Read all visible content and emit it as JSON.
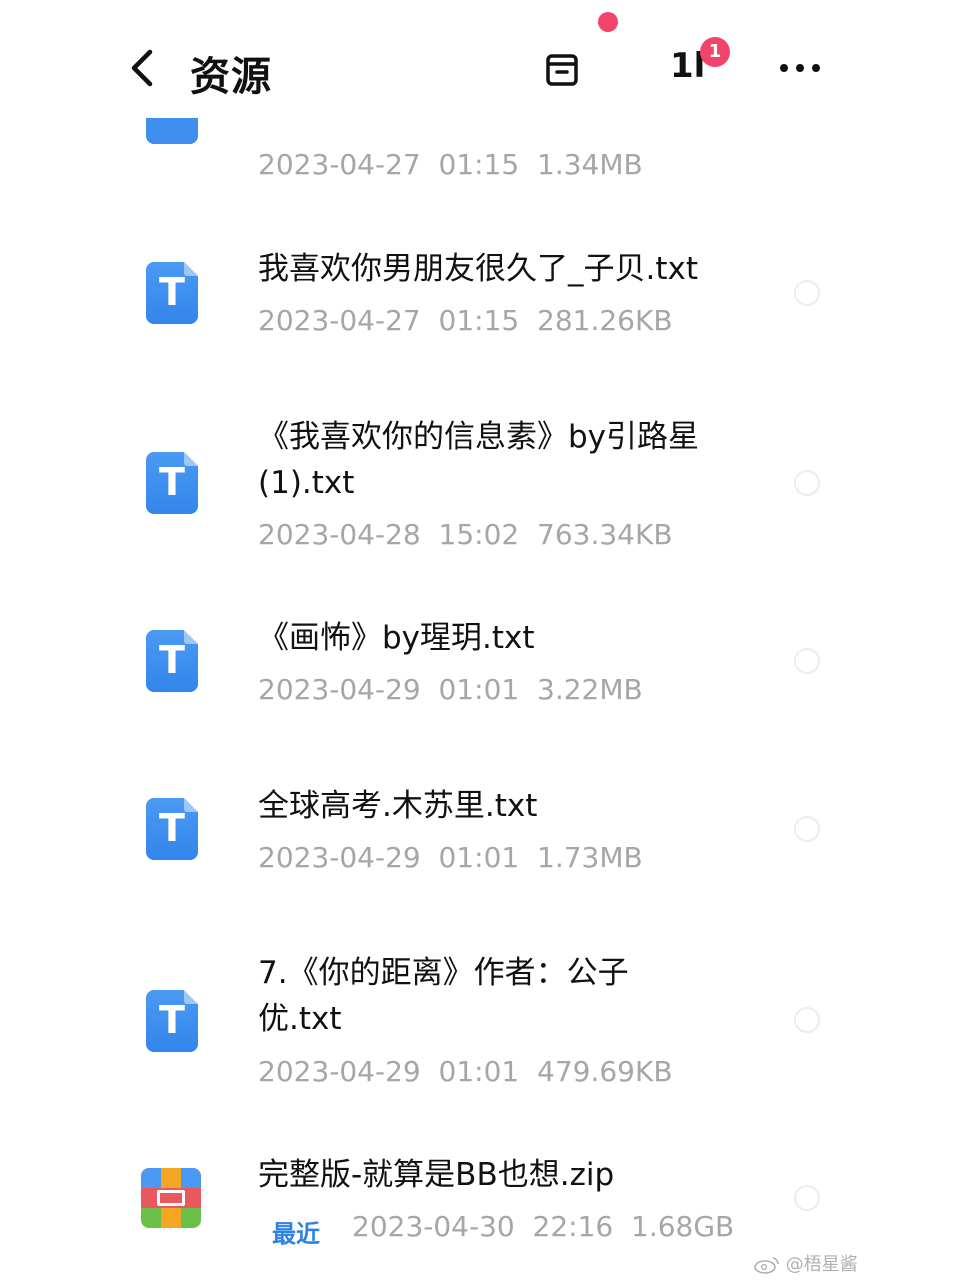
{
  "header": {
    "title": "资源",
    "sort_glyph": "1l",
    "badge_count": "1"
  },
  "files": [
    {
      "name": "",
      "date": "2023-04-27  01:15  1.34MB",
      "icon": "txt-file-icon"
    },
    {
      "name": "我喜欢你男朋友很久了_子贝.txt",
      "date": "2023-04-27  01:15  281.26KB",
      "icon": "txt-file-icon"
    },
    {
      "name": "《我喜欢你的信息素》by引路星(1).txt",
      "date": "2023-04-28  15:02  763.34KB",
      "icon": "txt-file-icon"
    },
    {
      "name": "《画怖》by瑆玥.txt",
      "date": "2023-04-29  01:01  3.22MB",
      "icon": "txt-file-icon"
    },
    {
      "name": "全球高考.木苏里.txt",
      "date": "2023-04-29  01:01  1.73MB",
      "icon": "txt-file-icon"
    },
    {
      "name": "7.《你的距离》作者：公子优.txt",
      "date": "2023-04-29  01:01  479.69KB",
      "icon": "txt-file-icon"
    },
    {
      "name": "完整版-就算是BB也想.zip",
      "date": "2023-04-30  22:16  1.68GB",
      "tag": "最近",
      "icon": "zip-file-icon"
    }
  ],
  "icon_letter": "T",
  "watermark": "@梧星酱",
  "colors": {
    "accent_blue": "#3f8ef0",
    "badge_red": "#f0446a",
    "meta_gray": "#a6a6a6",
    "recent_blue": "#2d82e6"
  }
}
